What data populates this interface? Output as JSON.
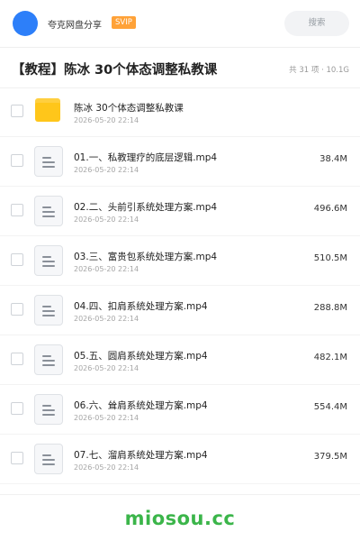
{
  "header": {
    "share_name": "夸克网盘分享",
    "badge": "SVIP",
    "search_placeholder": "搜索",
    "avatar_color": "#2d7ff9"
  },
  "share": {
    "title": "【教程】陈冰 30个体态调整私教课",
    "meta": "共 31 项 · 10.1G"
  },
  "items": [
    {
      "type": "folder",
      "name": "陈冰 30个体态调整私教课",
      "time": "2026-05-20 22:14",
      "size": ""
    },
    {
      "type": "file",
      "name": "01.一、私教理疗的底层逻辑.mp4",
      "time": "2026-05-20 22:14",
      "size": "38.4M"
    },
    {
      "type": "file",
      "name": "02.二、头前引系统处理方案.mp4",
      "time": "2026-05-20 22:14",
      "size": "496.6M"
    },
    {
      "type": "file",
      "name": "03.三、富贵包系统处理方案.mp4",
      "time": "2026-05-20 22:14",
      "size": "510.5M"
    },
    {
      "type": "file",
      "name": "04.四、扣肩系统处理方案.mp4",
      "time": "2026-05-20 22:14",
      "size": "288.8M"
    },
    {
      "type": "file",
      "name": "05.五、圆肩系统处理方案.mp4",
      "time": "2026-05-20 22:14",
      "size": "482.1M"
    },
    {
      "type": "file",
      "name": "06.六、耸肩系统处理方案.mp4",
      "time": "2026-05-20 22:14",
      "size": "554.4M"
    },
    {
      "type": "file",
      "name": "07.七、溜肩系统处理方案.mp4",
      "time": "2026-05-20 22:14",
      "size": "379.5M"
    }
  ],
  "footer": {
    "watermark": "miosou.cc",
    "watermark_color": "#3bb54a"
  }
}
